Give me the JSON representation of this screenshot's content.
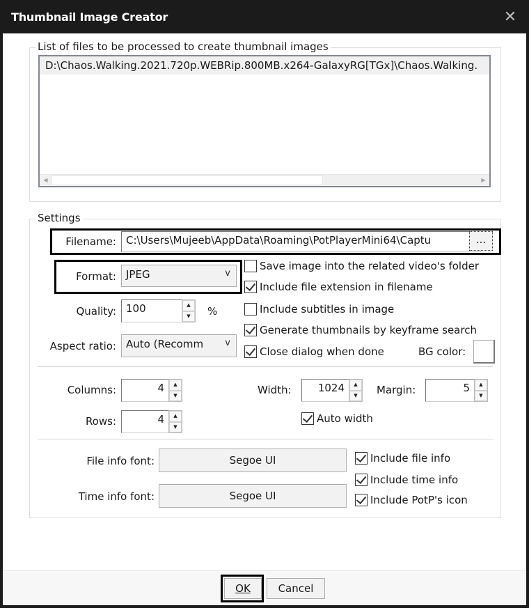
{
  "window": {
    "title": "Thumbnail Image Creator",
    "close_label": "✕"
  },
  "files_group": {
    "label": "List of files to be processed to create thumbnail images",
    "items": [
      "D:\\Chaos.Walking.2021.720p.WEBRip.800MB.x264-GalaxyRG[TGx]\\Chaos.Walking."
    ],
    "scroll_left": "◀",
    "scroll_right": "▶"
  },
  "settings": {
    "label": "Settings",
    "filename": {
      "label": "Filename:",
      "value": "C:\\Users\\Mujeeb\\AppData\\Roaming\\PotPlayerMini64\\Captu",
      "browse_label": "..."
    },
    "format": {
      "label": "Format:",
      "value": "JPEG",
      "arrow": "v"
    },
    "quality": {
      "label": "Quality:",
      "value": "100",
      "unit": "%"
    },
    "aspect_ratio": {
      "label": "Aspect ratio:",
      "value": "Auto (Recomm",
      "arrow": "v"
    },
    "options": [
      {
        "label": "Save image into the related video's folder",
        "checked": false
      },
      {
        "label": "Include file extension in filename",
        "checked": true
      },
      {
        "label": "Include subtitles in image",
        "checked": false
      },
      {
        "label": "Generate thumbnails by keyframe search",
        "checked": true
      },
      {
        "label": "Close dialog when done",
        "checked": true
      }
    ],
    "bg_color": {
      "label": "BG color:",
      "value": "#ffffff"
    },
    "columns": {
      "label": "Columns:",
      "value": "4"
    },
    "rows": {
      "label": "Rows:",
      "value": "4"
    },
    "width": {
      "label": "Width:",
      "value": "1024"
    },
    "margin": {
      "label": "Margin:",
      "value": "5"
    },
    "auto_width": {
      "label": "Auto width",
      "checked": true
    },
    "file_info_font": {
      "label": "File info font:",
      "value": "Segoe UI"
    },
    "time_info_font": {
      "label": "Time info font:",
      "value": "Segoe UI"
    },
    "info_options": [
      {
        "label": "Include file info",
        "checked": true
      },
      {
        "label": "Include time info",
        "checked": true
      },
      {
        "label": "Include PotP's icon",
        "checked": true
      }
    ],
    "spin_up": "▲",
    "spin_down": "▼"
  },
  "footer": {
    "ok_label": "OK",
    "cancel_label": "Cancel"
  }
}
